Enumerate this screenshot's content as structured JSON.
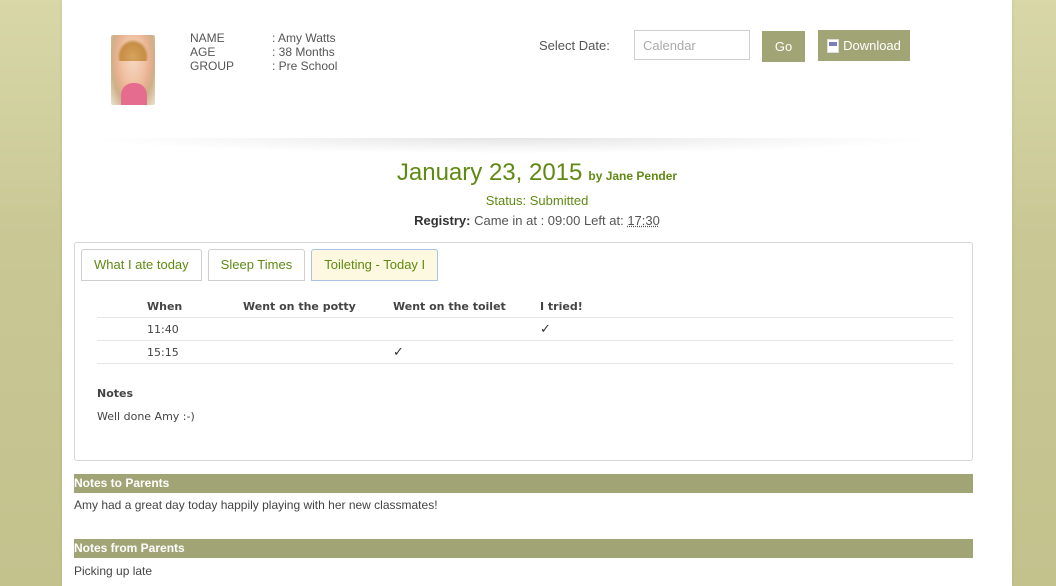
{
  "child": {
    "name_label": "NAME",
    "name_value": ": Amy Watts",
    "age_label": "AGE",
    "age_value": ": 38 Months",
    "group_label": "GROUP",
    "group_value": ": Pre School"
  },
  "date_picker": {
    "label": "Select Date:",
    "placeholder": "Calendar",
    "go_label": "Go",
    "download_label": "Download"
  },
  "report": {
    "date": "January 23, 2015",
    "by": "by Jane Pender",
    "status": "Status: Submitted",
    "registry_label": "Registry:",
    "registry_text": "Came in at : 09:00 Left at: ",
    "left_time": "17:30"
  },
  "tabs": [
    {
      "label": "What I ate today",
      "active": false
    },
    {
      "label": "Sleep Times",
      "active": false
    },
    {
      "label": "Toileting - Today I",
      "active": true
    }
  ],
  "toileting": {
    "headers": [
      "When",
      "Went on the potty",
      "Went on the toilet",
      "I tried!"
    ],
    "rows": [
      [
        "11:40",
        "",
        "",
        "✓"
      ],
      [
        "15:15",
        "",
        "✓",
        ""
      ]
    ],
    "notes_heading": "Notes",
    "notes_text": "Well done Amy :-)"
  },
  "notes_to_parents": {
    "heading": "Notes to Parents",
    "text": "Amy had a great day today happily playing with her new classmates!"
  },
  "notes_from_parents": {
    "heading": "Notes from Parents",
    "text": "Picking up late"
  },
  "colors": {
    "accent_green": "#5f8a12",
    "section_bar": "#a1a576",
    "page_bg": "#c9c895"
  }
}
